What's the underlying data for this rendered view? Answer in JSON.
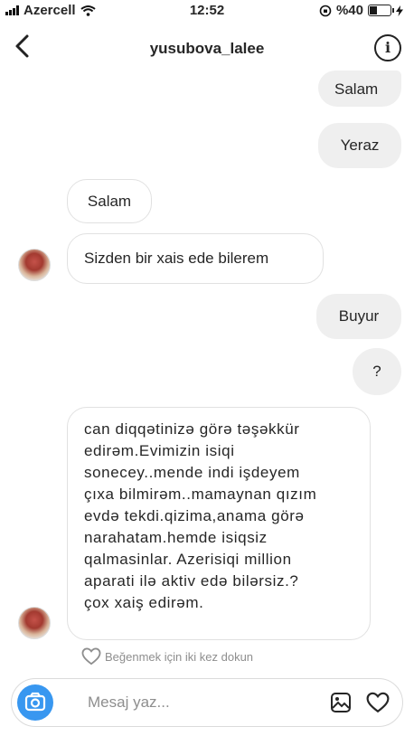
{
  "status_bar": {
    "carrier": "Azercell",
    "time": "12:52",
    "battery": "%40",
    "battery_level": 0.4
  },
  "header": {
    "username": "yusubova_lalee"
  },
  "messages": [
    {
      "side": "sent",
      "text": "Salam"
    },
    {
      "side": "sent",
      "text": "Yeraz"
    },
    {
      "side": "received",
      "text": "Salam"
    },
    {
      "side": "received",
      "text": "Sizden bir xais ede bilerem"
    },
    {
      "side": "sent",
      "text": "Buyur"
    },
    {
      "side": "sent",
      "text": "?"
    },
    {
      "side": "received",
      "lines": [
        "can diqqətinizə görə təşəkkür",
        "edirəm.Evimizin isiqi",
        "sonecey..mende indi işdeyem",
        "çıxa bilmirəm..mamaynan qızım",
        "evdə tekdi.qizima,anama  görə",
        "narahatam.hemde isiqsiz",
        "qalmasinlar. Azerisiqi million",
        "aparati ilə aktiv edə bilərsiz.?",
        "çox xaiş edirəm."
      ]
    }
  ],
  "like_hint": "Beğenmek için iki kez dokun",
  "composer": {
    "placeholder": "Mesaj yaz..."
  },
  "colors": {
    "accent": "#3897f0",
    "sent_bubble": "#efefef",
    "received_border": "#e1e1e1"
  },
  "icons": [
    "wifi-icon",
    "back-chevron-icon",
    "info-icon",
    "avatar",
    "heart-outline-icon",
    "camera-icon",
    "gallery-icon"
  ]
}
